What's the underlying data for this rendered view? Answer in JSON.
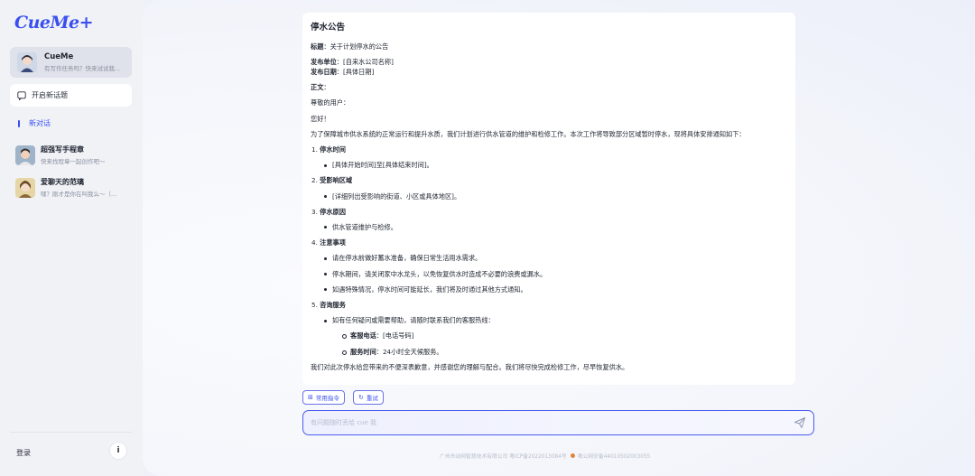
{
  "brand": {
    "logo": "CueMe+"
  },
  "sidebar": {
    "agent": {
      "name": "CueMe",
      "subtitle": "有写作任务吗？快来试试我..."
    },
    "new_topic": "开启新话题",
    "active_conversation": "新对话",
    "agents": [
      {
        "name": "超强写手程章",
        "subtitle": "快来找程章一起创作吧～"
      },
      {
        "name": "爱聊天的范璃",
        "subtitle": "嘿？刚才是你在叫我么～（..."
      }
    ],
    "login": "登录",
    "info_icon": "info-icon"
  },
  "document": {
    "heading": "停水公告",
    "title_label": "标题",
    "title_value": "：关于计划停水的公告",
    "publisher_label": "发布单位",
    "publisher_value": "：[自来水公司名称]",
    "date_label": "发布日期",
    "date_value": "：[具体日期]",
    "body_label": "正文",
    "body_colon": "：",
    "greeting": "尊敬的用户：",
    "hello": "您好！",
    "intro": "为了保障城市供水系统的正常运行和提升水质，我们计划进行供水管道的维护和检修工作。本次工作将导致部分区域暂时停水，现将具体安排通知如下：",
    "sections": [
      {
        "num": "1.",
        "title": "停水时间",
        "items": [
          "[具体开始时间]至[具体结束时间]。"
        ]
      },
      {
        "num": "2.",
        "title": "受影响区域",
        "items": [
          "[详细列出受影响的街道、小区或具体地区]。"
        ]
      },
      {
        "num": "3.",
        "title": "停水原因",
        "items": [
          "供水管道维护与检修。"
        ]
      },
      {
        "num": "4.",
        "title": "注意事项",
        "items": [
          "请在停水前做好蓄水准备，确保日常生活用水需求。",
          "停水期间，请关闭家中水龙头，以免恢复供水时造成不必要的浪费或漏水。",
          "如遇特殊情况，停水时间可能延长，我们将及时通过其他方式通知。"
        ]
      },
      {
        "num": "5.",
        "title": "咨询服务",
        "items": [
          "如有任何疑问或需要帮助，请随时联系我们的客服热线："
        ]
      }
    ],
    "contact": [
      {
        "label": "客服电话",
        "value": "：[电话号码]"
      },
      {
        "label": "服务时间",
        "value": "：24小时全天候服务。"
      }
    ],
    "closing_cut": "我们对此次停水给您带来的不便深表歉意，并感谢您的理解与配合。我们将尽快完成检修工作，尽早恢复供水。"
  },
  "actions": {
    "common_commands": "常用指令",
    "retry": "重试"
  },
  "input": {
    "placeholder": "有问题随时丢给 cue 我",
    "value": ""
  },
  "footer": {
    "company": "广州市动网智慧技术有限公司 粤ICP备2022013084号",
    "police": "粤公网安备44010502003055"
  },
  "colors": {
    "accent": "#3a4ff0",
    "sidebar_bg": "#f0f2f6"
  }
}
